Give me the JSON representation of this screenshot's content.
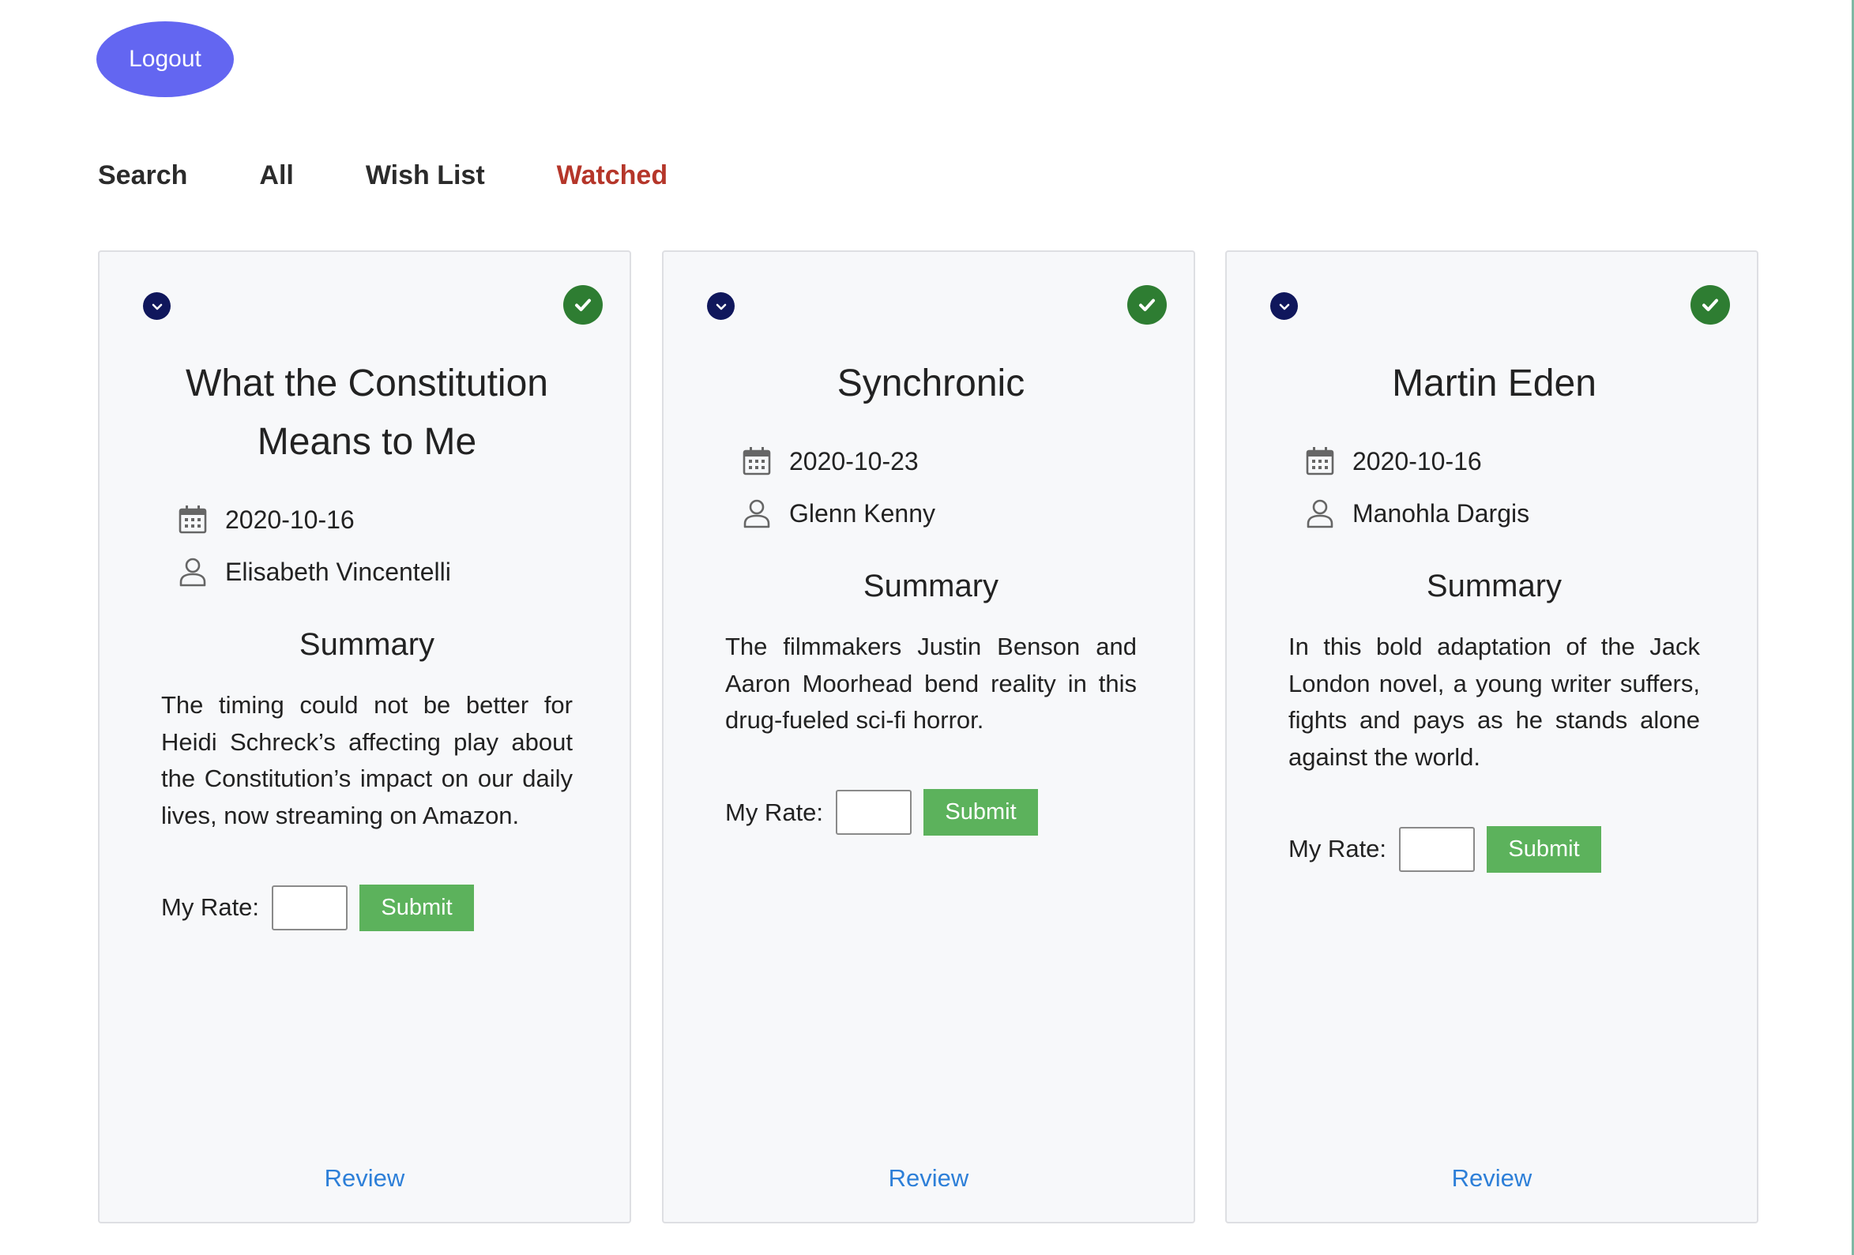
{
  "header": {
    "logout_label": "Logout"
  },
  "nav": {
    "tabs": [
      {
        "label": "Search"
      },
      {
        "label": "All"
      },
      {
        "label": "Wish List"
      },
      {
        "label": "Watched"
      }
    ],
    "active": "Watched"
  },
  "rate_label": "My Rate:",
  "submit_label": "Submit",
  "summary_heading": "Summary",
  "review_label": "Review",
  "movies": [
    {
      "title": "What the Constitution Means to Me",
      "date": "2020-10-16",
      "author": "Elisabeth Vincentelli",
      "summary": "The timing could not be better for Heidi Schreck’s affecting play about the Constitution’s impact on our daily lives, now streaming on Amazon.",
      "rate_value": ""
    },
    {
      "title": "Synchronic",
      "date": "2020-10-23",
      "author": "Glenn Kenny",
      "summary": "The filmmakers Justin Benson and Aaron Moorhead bend reality in this drug-fueled sci-fi horror.",
      "rate_value": ""
    },
    {
      "title": "Martin Eden",
      "date": "2020-10-16",
      "author": "Manohla Dargis",
      "summary": "In this bold adaptation of the Jack London novel, a young writer suffers, fights and pays as he stands alone against the world.",
      "rate_value": ""
    }
  ],
  "icons": {
    "toggle": "chevron-down-icon",
    "watched": "check-circle-icon",
    "date": "calendar-icon",
    "author": "user-icon"
  },
  "colors": {
    "logout_bg": "#6366f1",
    "active_tab": "#b5362a",
    "watched_icon": "#2e7d32",
    "toggle_icon": "#10175c",
    "submit_bg": "#5cb25c",
    "review_link": "#2d7fd8"
  }
}
